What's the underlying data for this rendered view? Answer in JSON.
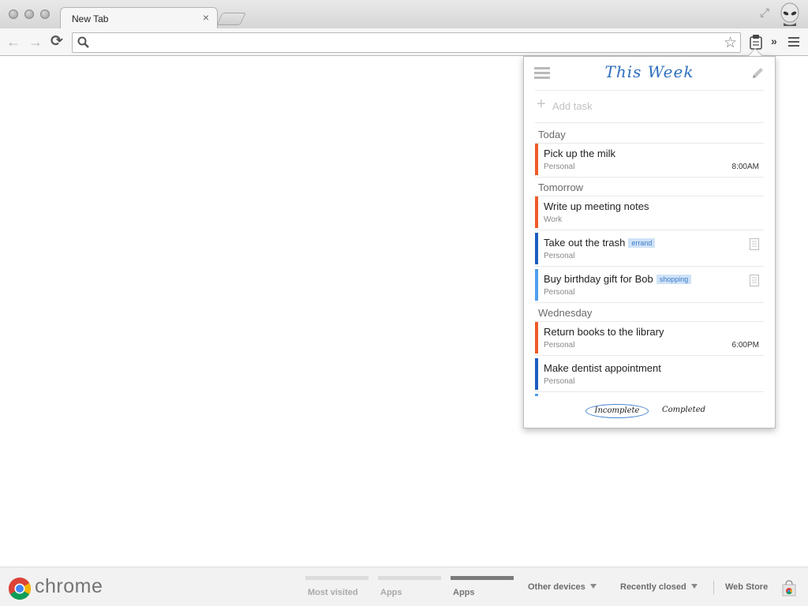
{
  "browser": {
    "tab_title": "New Tab",
    "tab_close": "×",
    "omnibox_value": "",
    "omnibox_placeholder": ""
  },
  "icons": {
    "back": "←",
    "forward": "→",
    "reload": "⟳",
    "star": "☆",
    "overflow": "»",
    "fullscreen": "⤢",
    "add": "+"
  },
  "popup": {
    "title": "This Week",
    "add_task_label": "Add task",
    "sections": [
      {
        "heading": "Today",
        "tasks": [
          {
            "title": "Pick up the milk",
            "list": "Personal",
            "time": "8:00AM",
            "tag": "",
            "color": "#f05a28",
            "has_note": false
          }
        ]
      },
      {
        "heading": "Tomorrow",
        "tasks": [
          {
            "title": "Write up meeting notes",
            "list": "Work",
            "time": "",
            "tag": "",
            "color": "#f05a28",
            "has_note": false
          },
          {
            "title": "Take out the trash",
            "list": "Personal",
            "time": "",
            "tag": "errand",
            "color": "#1c5cbf",
            "has_note": true
          },
          {
            "title": "Buy birthday gift for Bob",
            "list": "Personal",
            "time": "",
            "tag": "shopping",
            "color": "#4f9ef0",
            "has_note": true
          }
        ]
      },
      {
        "heading": "Wednesday",
        "tasks": [
          {
            "title": "Return books to the library",
            "list": "Personal",
            "time": "6:00PM",
            "tag": "",
            "color": "#f05a28",
            "has_note": false
          },
          {
            "title": "Make dentist appointment",
            "list": "Personal",
            "time": "",
            "tag": "",
            "color": "#1c5cbf",
            "has_note": false
          }
        ]
      }
    ],
    "filters": {
      "incomplete": "Incomplete",
      "completed": "Completed",
      "active": "incomplete"
    }
  },
  "ntp_footer": {
    "brand": "chrome",
    "tabs": [
      {
        "label": "Most visited",
        "active": false
      },
      {
        "label": "Apps",
        "active": false
      },
      {
        "label": "Apps",
        "active": true
      }
    ],
    "other_devices": "Other devices",
    "recently_closed": "Recently closed",
    "web_store": "Web Store"
  },
  "colors": {
    "accent_blue": "#2f6fbd",
    "priority_high": "#f05a28",
    "priority_medium": "#1c5cbf",
    "priority_low": "#4f9ef0",
    "tag_bg": "#cfe2f7"
  }
}
